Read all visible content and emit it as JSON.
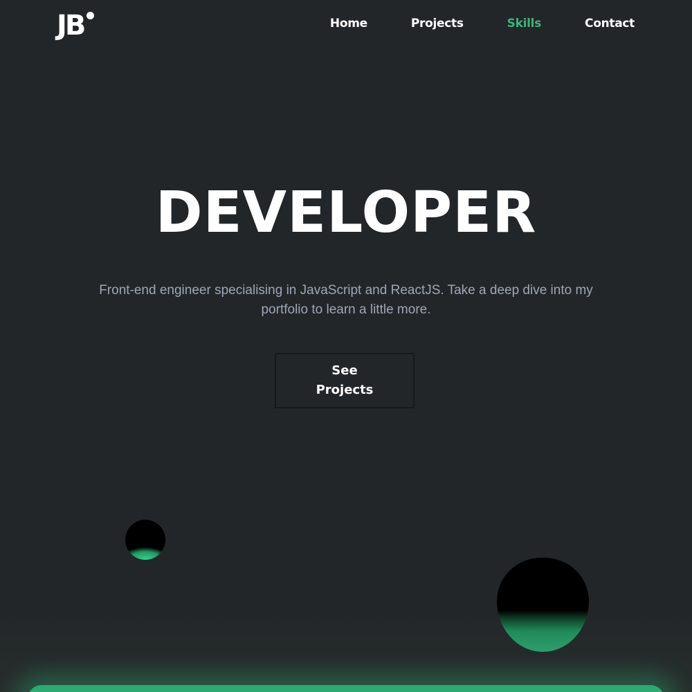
{
  "header": {
    "logo_text": "JB",
    "nav": [
      {
        "label": "Home"
      },
      {
        "label": "Projects"
      },
      {
        "label": "Skills"
      },
      {
        "label": "Contact"
      }
    ],
    "active_nav": "Skills"
  },
  "hero": {
    "title": "DEVELOPER",
    "subtitle": "Front-end engineer specialising in JavaScript and ReactJS. Take a deep dive into my portfolio to learn a little more.",
    "cta_label": "See Projects"
  },
  "colors": {
    "background": "#232629",
    "accent": "#3bb57a",
    "text": "#ffffff",
    "muted_text": "#9ea7b3"
  }
}
